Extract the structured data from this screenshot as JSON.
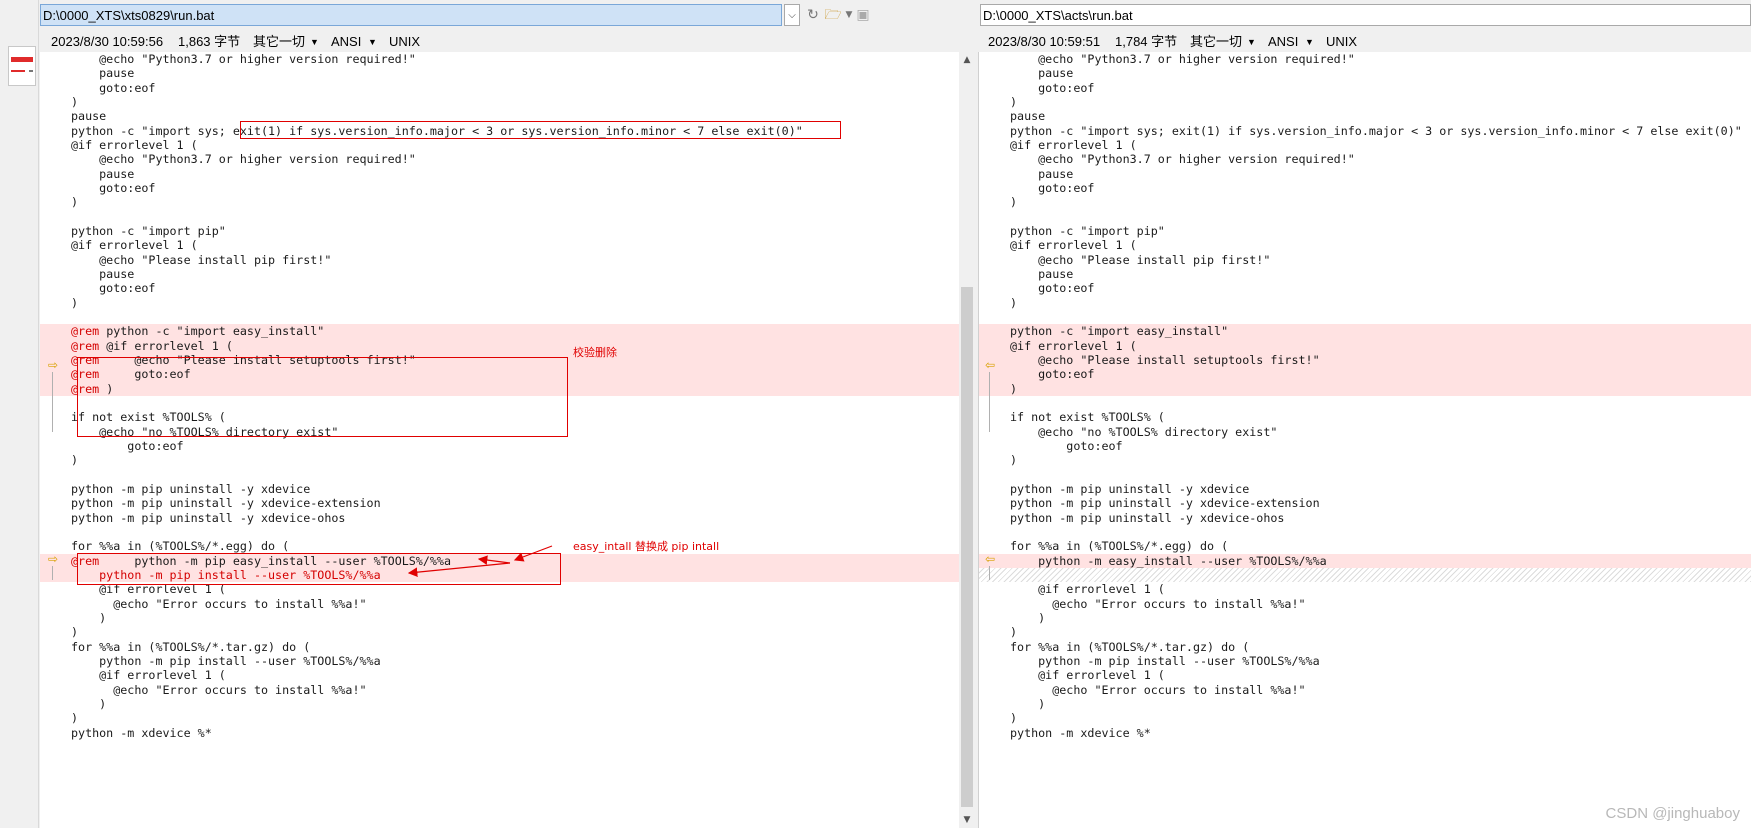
{
  "left": {
    "path": "D:\\0000_XTS\\xts0829\\run.bat",
    "date": "2023/8/30 10:59:56",
    "size": "1,863 字节",
    "filter": "其它一切",
    "encoding": "ANSI",
    "eol": "UNIX",
    "lines": [
      {
        "t": "    @echo \"Python3.7 or higher version required!\""
      },
      {
        "t": "    pause"
      },
      {
        "t": "    goto:eof"
      },
      {
        "t": ")"
      },
      {
        "t": "pause"
      },
      {
        "t": "python -c \"import sys; exit(1) if sys.version_info.major < 3 or sys.version_info.minor < 7 else exit(0)\""
      },
      {
        "t": "@if errorlevel 1 ("
      },
      {
        "t": "    @echo \"Python3.7 or higher version required!\""
      },
      {
        "t": "    pause"
      },
      {
        "t": "    goto:eof"
      },
      {
        "t": ")"
      },
      {
        "t": ""
      },
      {
        "t": "python -c \"import pip\""
      },
      {
        "t": "@if errorlevel 1 ("
      },
      {
        "t": "    @echo \"Please install pip first!\""
      },
      {
        "t": "    pause"
      },
      {
        "t": "    goto:eof"
      },
      {
        "t": ")"
      },
      {
        "t": ""
      },
      {
        "t": " python -c \"import easy_install\"",
        "r": "@rem",
        "c": true
      },
      {
        "t": " @if errorlevel 1 (",
        "r": "@rem",
        "c": true
      },
      {
        "t": "     @echo \"Please install setuptools first!\"",
        "r": "@rem",
        "c": true
      },
      {
        "t": "     goto:eof",
        "r": "@rem",
        "c": true
      },
      {
        "t": " )",
        "r": "@rem",
        "c": true
      },
      {
        "t": ""
      },
      {
        "t": "if not exist %TOOLS% ("
      },
      {
        "t": "    @echo \"no %TOOLS% directory exist\""
      },
      {
        "t": "        goto:eof"
      },
      {
        "t": ")"
      },
      {
        "t": ""
      },
      {
        "t": "python -m pip uninstall -y xdevice"
      },
      {
        "t": "python -m pip uninstall -y xdevice-extension"
      },
      {
        "t": "python -m pip uninstall -y xdevice-ohos"
      },
      {
        "t": ""
      },
      {
        "t": "for %%a in (%TOOLS%/*.egg) do ("
      },
      {
        "t": "     python -m pip easy_install --user %TOOLS%/%%a",
        "r": "@rem",
        "c": true
      },
      {
        "t": "    python -m pip install --user %TOOLS%/%%a",
        "c": true,
        "allred": true
      },
      {
        "t": "    @if errorlevel 1 ("
      },
      {
        "t": "      @echo \"Error occurs to install %%a!\""
      },
      {
        "t": "    )"
      },
      {
        "t": ")"
      },
      {
        "t": "for %%a in (%TOOLS%/*.tar.gz) do ("
      },
      {
        "t": "    python -m pip install --user %TOOLS%/%%a"
      },
      {
        "t": "    @if errorlevel 1 ("
      },
      {
        "t": "      @echo \"Error occurs to install %%a!\""
      },
      {
        "t": "    )"
      },
      {
        "t": ")"
      },
      {
        "t": "python -m xdevice %*"
      }
    ]
  },
  "right": {
    "path": "D:\\0000_XTS\\acts\\run.bat",
    "date": "2023/8/30 10:59:51",
    "size": "1,784 字节",
    "filter": "其它一切",
    "encoding": "ANSI",
    "eol": "UNIX",
    "lines": [
      {
        "t": "    @echo \"Python3.7 or higher version required!\""
      },
      {
        "t": "    pause"
      },
      {
        "t": "    goto:eof"
      },
      {
        "t": ")"
      },
      {
        "t": "pause"
      },
      {
        "t": "python -c \"import sys; exit(1) if sys.version_info.major < 3 or sys.version_info.minor < 7 else exit(0)\""
      },
      {
        "t": "@if errorlevel 1 ("
      },
      {
        "t": "    @echo \"Python3.7 or higher version required!\""
      },
      {
        "t": "    pause"
      },
      {
        "t": "    goto:eof"
      },
      {
        "t": ")"
      },
      {
        "t": ""
      },
      {
        "t": "python -c \"import pip\""
      },
      {
        "t": "@if errorlevel 1 ("
      },
      {
        "t": "    @echo \"Please install pip first!\""
      },
      {
        "t": "    pause"
      },
      {
        "t": "    goto:eof"
      },
      {
        "t": ")"
      },
      {
        "t": ""
      },
      {
        "t": "python -c \"import easy_install\"",
        "c": true
      },
      {
        "t": "@if errorlevel 1 (",
        "c": true
      },
      {
        "t": "    @echo \"Please install setuptools first!\"",
        "c": true
      },
      {
        "t": "    goto:eof",
        "c": true
      },
      {
        "t": ")",
        "c": true
      },
      {
        "t": ""
      },
      {
        "t": "if not exist %TOOLS% ("
      },
      {
        "t": "    @echo \"no %TOOLS% directory exist\""
      },
      {
        "t": "        goto:eof"
      },
      {
        "t": ")"
      },
      {
        "t": ""
      },
      {
        "t": "python -m pip uninstall -y xdevice"
      },
      {
        "t": "python -m pip uninstall -y xdevice-extension"
      },
      {
        "t": "python -m pip uninstall -y xdevice-ohos"
      },
      {
        "t": ""
      },
      {
        "t": "for %%a in (%TOOLS%/*.egg) do ("
      },
      {
        "t": "    python -m easy_install --user %TOOLS%/%%a",
        "c": true
      },
      {
        "t": "",
        "hatch": true
      },
      {
        "t": "    @if errorlevel 1 ("
      },
      {
        "t": "      @echo \"Error occurs to install %%a!\""
      },
      {
        "t": "    )"
      },
      {
        "t": ")"
      },
      {
        "t": "for %%a in (%TOOLS%/*.tar.gz) do ("
      },
      {
        "t": "    python -m pip install --user %TOOLS%/%%a"
      },
      {
        "t": "    @if errorlevel 1 ("
      },
      {
        "t": "      @echo \"Error occurs to install %%a!\""
      },
      {
        "t": "    )"
      },
      {
        "t": ")"
      },
      {
        "t": "python -m xdevice %*"
      }
    ]
  },
  "annotations": {
    "delete_note": "校验删除",
    "replace_note": "easy_intall 替换成 pip intall"
  },
  "watermark": "CSDN @jinghuaboy",
  "icons": {
    "dropdown": "chevron-down-icon",
    "history": "history-icon",
    "open_folder": "folder-open-icon",
    "save": "save-icon",
    "diff_marker": "arrow-right-icon"
  },
  "colors": {
    "changed_bg": "#ffe2e2",
    "annotation": "#e00000",
    "marker": "#d8a000"
  }
}
